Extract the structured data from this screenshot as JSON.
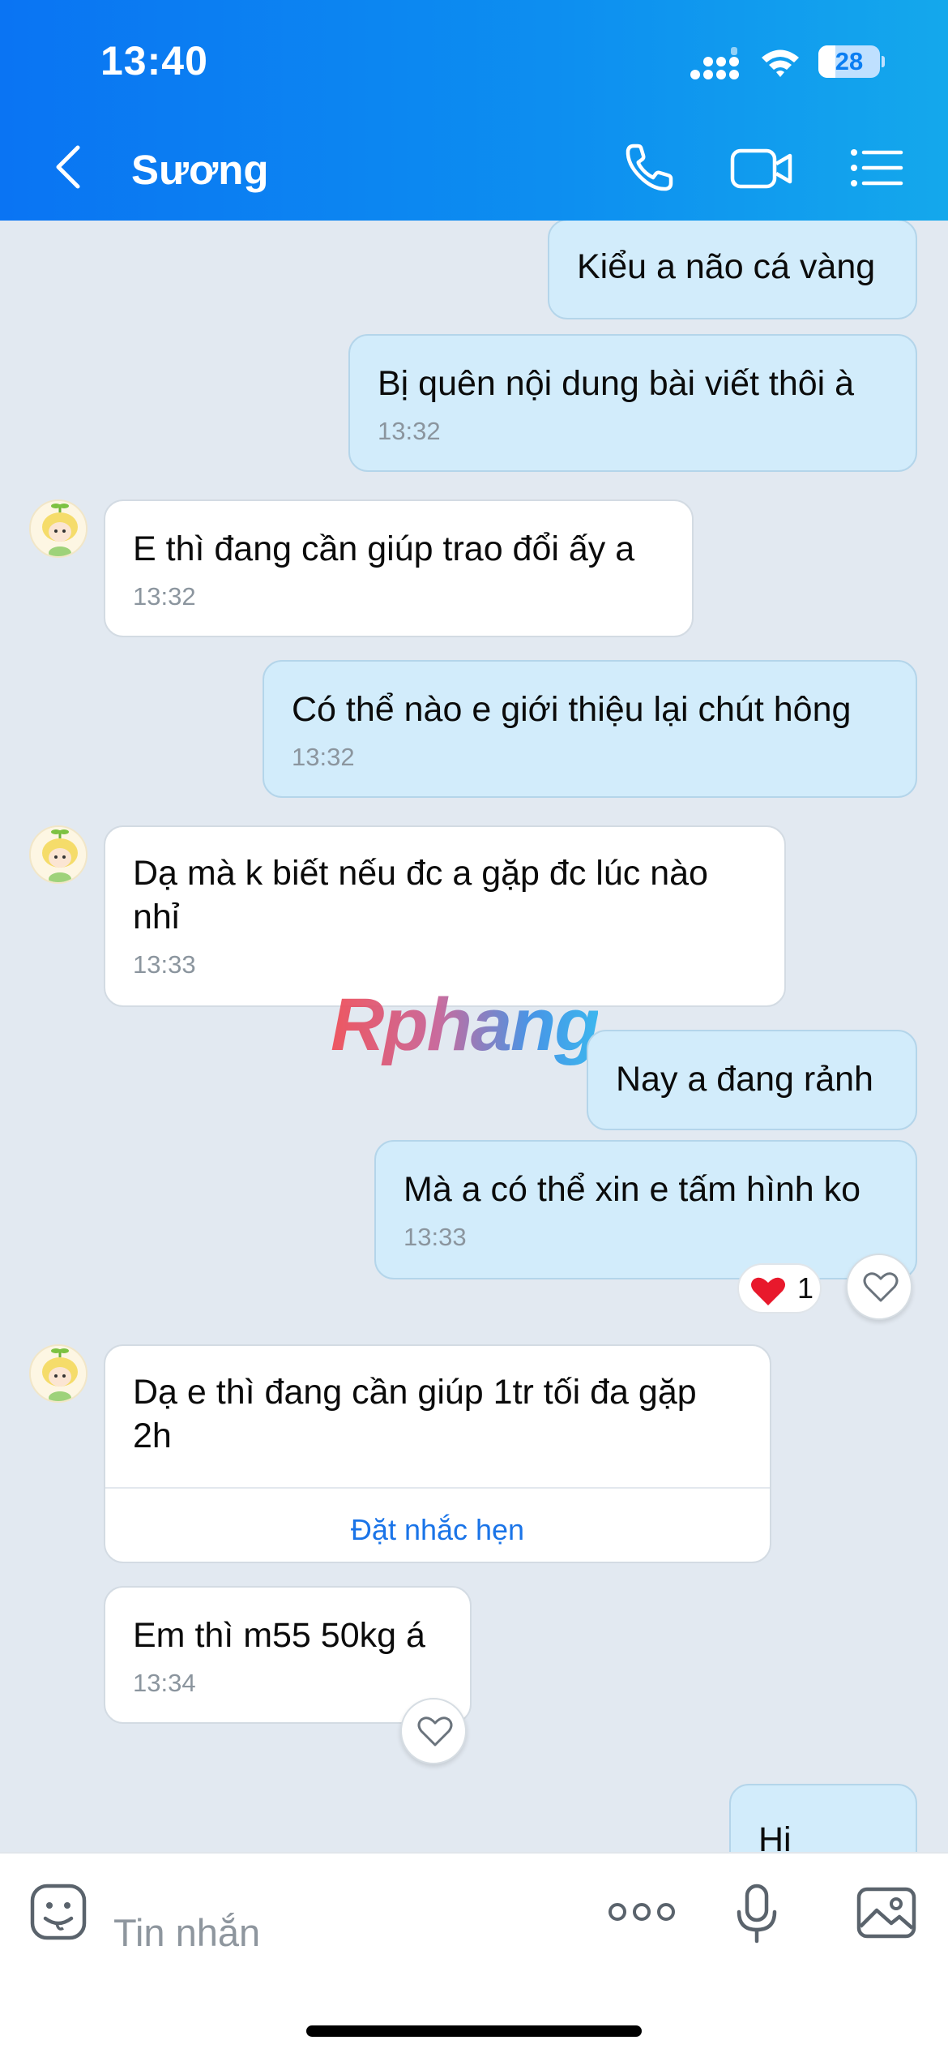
{
  "status_bar": {
    "time": "13:40",
    "battery": "28",
    "battery_level_percent": 28
  },
  "header": {
    "contact_name": "Sương"
  },
  "messages": [
    {
      "text": "Kiểu a não cá vàng",
      "time": ""
    },
    {
      "text": "Bị quên nội dung bài viết thôi à",
      "time": "13:32"
    },
    {
      "text": "E thì đang cần giúp trao đổi ấy a",
      "time": "13:32"
    },
    {
      "text": "Có thể nào e giới thiệu lại chút hông",
      "time": "13:32"
    },
    {
      "text": "Dạ mà k biết nếu đc a gặp đc lúc nào nhỉ",
      "time": "13:33"
    },
    {
      "text": "Nay a đang rảnh",
      "time": ""
    },
    {
      "text": "Mà a có thể xin e tấm hình ko",
      "time": "13:33",
      "reaction_count": "1"
    },
    {
      "text": "Dạ e thì đang cần giúp 1tr tối đa gặp 2h",
      "reminder_link": "Đặt nhắc hẹn"
    },
    {
      "text": "Em thì m55 50kg á",
      "time": "13:34"
    },
    {
      "text": "Hi",
      "time": ""
    }
  ],
  "watermark": "Rphang",
  "input": {
    "placeholder": "Tin nhắn"
  },
  "colors": {
    "header_gradient_start": "#0a74f3",
    "header_gradient_end": "#14a8ec",
    "my_bubble": "#d2ecfb",
    "their_bubble": "#ffffff",
    "chat_background": "#e2e9f1",
    "reaction_heart": "#e8192c",
    "link": "#1a74e8"
  },
  "icons": {
    "header": [
      "back-chevron-icon",
      "phone-icon",
      "video-call-icon",
      "menu-list-icon"
    ],
    "input_bar": [
      "sticker-icon",
      "more-icon",
      "microphone-icon",
      "image-icon"
    ]
  }
}
